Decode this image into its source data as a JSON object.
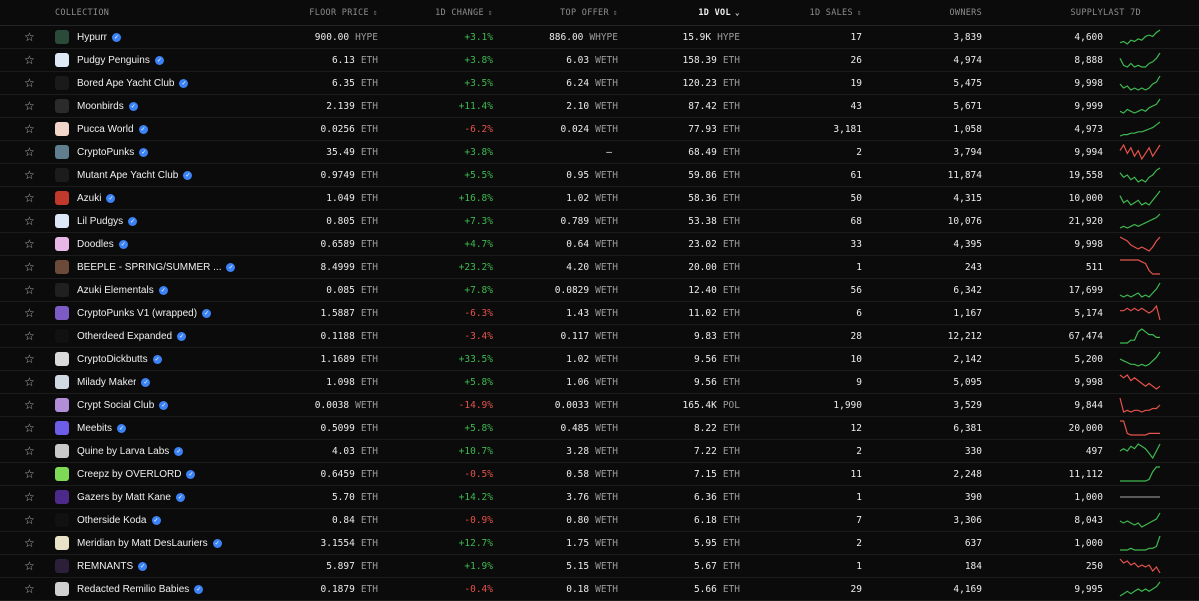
{
  "header": {
    "collection": "COLLECTION",
    "floor_price": "FLOOR PRICE",
    "change_1d": "1D CHANGE",
    "top_offer": "TOP OFFER",
    "vol_1d": "1D VOL",
    "sales_1d": "1D SALES",
    "owners": "OWNERS",
    "supply": "SUPPLY",
    "last_7d": "LAST 7D",
    "sort_icon": "⇕",
    "sort_active_icon": "⌄"
  },
  "colors": {
    "positive": "#3fb950",
    "negative": "#e5534b",
    "flat": "#8a8a8a",
    "verified": "#3b82f6"
  },
  "rows": [
    {
      "name": "Hypurr",
      "thumb": "#2a4a3a",
      "floor": "900.00",
      "floor_unit": "HYPE",
      "change": "+3.1%",
      "dir": "up",
      "offer": "886.00",
      "offer_unit": "WHYPE",
      "vol": "15.9K",
      "vol_unit": "HYPE",
      "sales": "17",
      "owners": "3,839",
      "supply": "4,600",
      "spark": [
        4,
        5,
        3,
        6,
        5,
        7,
        6,
        9,
        10,
        9,
        12,
        14
      ]
    },
    {
      "name": "Pudgy Penguins",
      "thumb": "#dfe9f5",
      "floor": "6.13",
      "floor_unit": "ETH",
      "change": "+3.8%",
      "dir": "up",
      "offer": "6.03",
      "offer_unit": "WETH",
      "vol": "158.39",
      "vol_unit": "ETH",
      "sales": "26",
      "owners": "4,974",
      "supply": "8,888",
      "spark": [
        10,
        6,
        5,
        7,
        5,
        6,
        5,
        5,
        7,
        8,
        10,
        13
      ]
    },
    {
      "name": "Bored Ape Yacht Club",
      "thumb": "#1a1a1a",
      "floor": "6.35",
      "floor_unit": "ETH",
      "change": "+3.5%",
      "dir": "up",
      "offer": "6.24",
      "offer_unit": "WETH",
      "vol": "120.23",
      "vol_unit": "ETH",
      "sales": "19",
      "owners": "5,475",
      "supply": "9,998",
      "spark": [
        8,
        6,
        7,
        5,
        6,
        5,
        6,
        5,
        6,
        8,
        9,
        12
      ]
    },
    {
      "name": "Moonbirds",
      "thumb": "#2b2b2b",
      "floor": "2.139",
      "floor_unit": "ETH",
      "change": "+11.4%",
      "dir": "up",
      "offer": "2.10",
      "offer_unit": "WETH",
      "vol": "87.42",
      "vol_unit": "ETH",
      "sales": "43",
      "owners": "5,671",
      "supply": "9,999",
      "spark": [
        6,
        5,
        7,
        6,
        5,
        6,
        7,
        6,
        8,
        9,
        10,
        13
      ]
    },
    {
      "name": "Pucca World",
      "thumb": "#f2d6c9",
      "floor": "0.0256",
      "floor_unit": "ETH",
      "change": "-6.2%",
      "dir": "up",
      "offer": "0.024",
      "offer_unit": "WETH",
      "vol": "77.93",
      "vol_unit": "ETH",
      "sales": "3,181",
      "owners": "1,058",
      "supply": "4,973",
      "spark": [
        3,
        4,
        4,
        5,
        5,
        6,
        6,
        7,
        8,
        9,
        11,
        13
      ]
    },
    {
      "name": "CryptoPunks",
      "thumb": "#5f7f8f",
      "floor": "35.49",
      "floor_unit": "ETH",
      "change": "+3.8%",
      "dir": "down",
      "offer": "—",
      "offer_unit": "",
      "vol": "68.49",
      "vol_unit": "ETH",
      "sales": "2",
      "owners": "3,794",
      "supply": "9,994",
      "spark": [
        9,
        11,
        8,
        10,
        7,
        9,
        6,
        8,
        10,
        7,
        9,
        11
      ]
    },
    {
      "name": "Mutant Ape Yacht Club",
      "thumb": "#1c1c1c",
      "floor": "0.9749",
      "floor_unit": "ETH",
      "change": "+5.5%",
      "dir": "up",
      "offer": "0.95",
      "offer_unit": "WETH",
      "vol": "59.86",
      "vol_unit": "ETH",
      "sales": "61",
      "owners": "11,874",
      "supply": "19,558",
      "spark": [
        10,
        8,
        9,
        7,
        8,
        6,
        7,
        6,
        8,
        9,
        11,
        12
      ]
    },
    {
      "name": "Azuki",
      "thumb": "#c0392b",
      "floor": "1.049",
      "floor_unit": "ETH",
      "change": "+16.8%",
      "dir": "up",
      "offer": "1.02",
      "offer_unit": "WETH",
      "vol": "58.36",
      "vol_unit": "ETH",
      "sales": "50",
      "owners": "4,315",
      "supply": "10,000",
      "spark": [
        10,
        7,
        8,
        6,
        7,
        8,
        6,
        7,
        6,
        8,
        10,
        12
      ]
    },
    {
      "name": "Lil Pudgys",
      "thumb": "#dbe7f7",
      "floor": "0.805",
      "floor_unit": "ETH",
      "change": "+7.3%",
      "dir": "up",
      "offer": "0.789",
      "offer_unit": "WETH",
      "vol": "53.38",
      "vol_unit": "ETH",
      "sales": "68",
      "owners": "10,076",
      "supply": "21,920",
      "spark": [
        4,
        5,
        4,
        5,
        6,
        5,
        6,
        7,
        8,
        9,
        10,
        12
      ]
    },
    {
      "name": "Doodles",
      "thumb": "#e8b7e6",
      "floor": "0.6589",
      "floor_unit": "ETH",
      "change": "+4.7%",
      "dir": "down",
      "offer": "0.64",
      "offer_unit": "WETH",
      "vol": "23.02",
      "vol_unit": "ETH",
      "sales": "33",
      "owners": "4,395",
      "supply": "9,998",
      "spark": [
        11,
        10,
        9,
        7,
        6,
        5,
        6,
        5,
        4,
        6,
        9,
        11
      ]
    },
    {
      "name": "BEEPLE - SPRING/SUMMER ...",
      "thumb": "#6b4a3a",
      "floor": "8.4999",
      "floor_unit": "ETH",
      "change": "+23.2%",
      "dir": "down",
      "offer": "4.20",
      "offer_unit": "WETH",
      "vol": "20.00",
      "vol_unit": "ETH",
      "sales": "1",
      "owners": "243",
      "supply": "511",
      "spark": [
        12,
        12,
        12,
        12,
        12,
        12,
        11,
        10,
        6,
        4,
        4,
        4
      ]
    },
    {
      "name": "Azuki Elementals",
      "thumb": "#202020",
      "floor": "0.085",
      "floor_unit": "ETH",
      "change": "+7.8%",
      "dir": "up",
      "offer": "0.0829",
      "offer_unit": "WETH",
      "vol": "12.40",
      "vol_unit": "ETH",
      "sales": "56",
      "owners": "6,342",
      "supply": "17,699",
      "spark": [
        6,
        5,
        6,
        5,
        6,
        7,
        5,
        6,
        5,
        7,
        9,
        12
      ]
    },
    {
      "name": "CryptoPunks V1 (wrapped)",
      "thumb": "#7c5cc4",
      "floor": "1.5887",
      "floor_unit": "ETH",
      "change": "-6.3%",
      "dir": "down",
      "offer": "1.43",
      "offer_unit": "WETH",
      "vol": "11.02",
      "vol_unit": "ETH",
      "sales": "6",
      "owners": "1,167",
      "supply": "5,174",
      "spark": [
        10,
        10,
        11,
        10,
        11,
        10,
        11,
        10,
        9,
        10,
        12,
        6
      ]
    },
    {
      "name": "Otherdeed Expanded",
      "thumb": "#111111",
      "floor": "0.1188",
      "floor_unit": "ETH",
      "change": "-3.4%",
      "dir": "up",
      "offer": "0.117",
      "offer_unit": "WETH",
      "vol": "9.83",
      "vol_unit": "ETH",
      "sales": "28",
      "owners": "12,212",
      "supply": "67,474",
      "spark": [
        5,
        5,
        5,
        6,
        6,
        9,
        10,
        9,
        8,
        8,
        7,
        7
      ]
    },
    {
      "name": "CryptoDickbutts",
      "thumb": "#d9d9d9",
      "floor": "1.1689",
      "floor_unit": "ETH",
      "change": "+33.5%",
      "dir": "up",
      "offer": "1.02",
      "offer_unit": "WETH",
      "vol": "9.56",
      "vol_unit": "ETH",
      "sales": "10",
      "owners": "2,142",
      "supply": "5,200",
      "spark": [
        8,
        7,
        6,
        5,
        5,
        4,
        5,
        4,
        5,
        7,
        9,
        12
      ]
    },
    {
      "name": "Milady Maker",
      "thumb": "#cfd8e3",
      "floor": "1.098",
      "floor_unit": "ETH",
      "change": "+5.8%",
      "dir": "down",
      "offer": "1.06",
      "offer_unit": "WETH",
      "vol": "9.56",
      "vol_unit": "ETH",
      "sales": "9",
      "owners": "5,095",
      "supply": "9,998",
      "spark": [
        10,
        9,
        10,
        8,
        9,
        8,
        7,
        6,
        7,
        6,
        5,
        6
      ]
    },
    {
      "name": "Crypt Social Club",
      "thumb": "#b38ed8",
      "floor": "0.0038",
      "floor_unit": "WETH",
      "change": "-14.9%",
      "dir": "down",
      "offer": "0.0033",
      "offer_unit": "WETH",
      "vol": "165.4K",
      "vol_unit": "POL",
      "sales": "1,990",
      "owners": "3,529",
      "supply": "9,844",
      "spark": [
        12,
        4,
        5,
        4,
        5,
        5,
        4,
        5,
        5,
        6,
        6,
        8
      ]
    },
    {
      "name": "Meebits",
      "thumb": "#6d5de8",
      "floor": "0.5099",
      "floor_unit": "ETH",
      "change": "+5.8%",
      "dir": "down",
      "offer": "0.485",
      "offer_unit": "WETH",
      "vol": "8.22",
      "vol_unit": "ETH",
      "sales": "12",
      "owners": "6,381",
      "supply": "20,000",
      "spark": [
        12,
        12,
        4,
        3,
        3,
        3,
        3,
        3,
        4,
        4,
        4,
        4
      ]
    },
    {
      "name": "Quine by Larva Labs",
      "thumb": "#c9c9c9",
      "floor": "4.03",
      "floor_unit": "ETH",
      "change": "+10.7%",
      "dir": "up",
      "offer": "3.28",
      "offer_unit": "WETH",
      "vol": "7.22",
      "vol_unit": "ETH",
      "sales": "2",
      "owners": "330",
      "supply": "497",
      "spark": [
        9,
        10,
        9,
        11,
        10,
        12,
        11,
        10,
        8,
        6,
        9,
        12
      ]
    },
    {
      "name": "Creepz by OVERLORD",
      "thumb": "#7ed957",
      "floor": "0.6459",
      "floor_unit": "ETH",
      "change": "-0.5%",
      "dir": "up",
      "offer": "0.58",
      "offer_unit": "WETH",
      "vol": "7.15",
      "vol_unit": "ETH",
      "sales": "11",
      "owners": "2,248",
      "supply": "11,112",
      "spark": [
        3,
        3,
        3,
        3,
        3,
        3,
        3,
        3,
        4,
        9,
        12,
        12
      ]
    },
    {
      "name": "Gazers by Matt Kane",
      "thumb": "#4b2a8a",
      "floor": "5.70",
      "floor_unit": "ETH",
      "change": "+14.2%",
      "dir": "flat",
      "offer": "3.76",
      "offer_unit": "WETH",
      "vol": "6.36",
      "vol_unit": "ETH",
      "sales": "1",
      "owners": "390",
      "supply": "1,000",
      "spark": [
        7,
        7,
        7,
        7,
        7,
        7,
        7,
        7,
        7,
        7,
        7,
        7
      ]
    },
    {
      "name": "Otherside Koda",
      "thumb": "#111111",
      "floor": "0.84",
      "floor_unit": "ETH",
      "change": "-0.9%",
      "dir": "up",
      "offer": "0.80",
      "offer_unit": "WETH",
      "vol": "6.18",
      "vol_unit": "ETH",
      "sales": "7",
      "owners": "3,306",
      "supply": "8,043",
      "spark": [
        8,
        7,
        8,
        7,
        6,
        7,
        5,
        6,
        7,
        8,
        9,
        12
      ]
    },
    {
      "name": "Meridian by Matt DesLauriers",
      "thumb": "#e9e2c8",
      "floor": "3.1554",
      "floor_unit": "ETH",
      "change": "+12.7%",
      "dir": "up",
      "offer": "1.75",
      "offer_unit": "WETH",
      "vol": "5.95",
      "vol_unit": "ETH",
      "sales": "2",
      "owners": "637",
      "supply": "1,000",
      "spark": [
        5,
        5,
        5,
        6,
        5,
        5,
        5,
        5,
        6,
        6,
        7,
        13
      ]
    },
    {
      "name": "REMNANTS",
      "thumb": "#2c1f3a",
      "floor": "5.897",
      "floor_unit": "ETH",
      "change": "+1.9%",
      "dir": "down",
      "offer": "5.15",
      "offer_unit": "WETH",
      "vol": "5.67",
      "vol_unit": "ETH",
      "sales": "1",
      "owners": "184",
      "supply": "250",
      "spark": [
        12,
        10,
        11,
        9,
        10,
        8,
        9,
        8,
        9,
        6,
        8,
        5
      ]
    },
    {
      "name": "Redacted Remilio Babies",
      "thumb": "#d0d0d0",
      "floor": "0.1879",
      "floor_unit": "ETH",
      "change": "-0.4%",
      "dir": "up",
      "offer": "0.18",
      "offer_unit": "WETH",
      "vol": "5.66",
      "vol_unit": "ETH",
      "sales": "29",
      "owners": "4,169",
      "supply": "9,995",
      "spark": [
        6,
        7,
        8,
        7,
        8,
        9,
        8,
        9,
        8,
        9,
        10,
        12
      ]
    }
  ]
}
